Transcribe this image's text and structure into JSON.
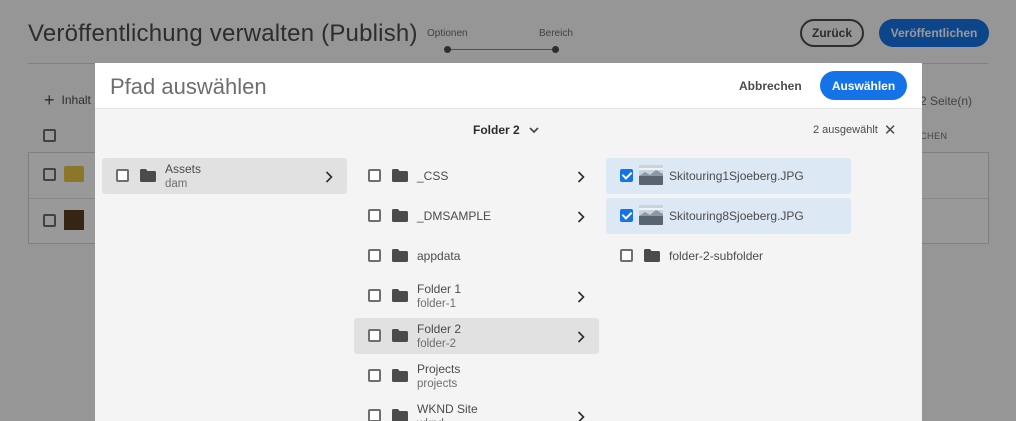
{
  "background": {
    "page_title": "Veröffentlichung verwalten (Publish)",
    "steps": [
      "Optionen",
      "Bereich"
    ],
    "back_label": "Zurück",
    "publish_label": "Veröffentlichen",
    "add_content_label": "Inhalt",
    "page_count": "2 Seite(n)",
    "column_header": "CHEN"
  },
  "dialog": {
    "title": "Pfad auswählen",
    "cancel_label": "Abbrechen",
    "select_label": "Auswählen",
    "current_folder": "Folder 2",
    "selected_count": "2 ausgewählt"
  },
  "columns": [
    {
      "items": [
        {
          "title": "Assets",
          "subtitle": "dam",
          "icon": "folder-icon",
          "checked": false,
          "has_children": true,
          "highlight": "grey"
        }
      ]
    },
    {
      "items": [
        {
          "title": "_CSS",
          "subtitle": "",
          "icon": "folder-icon",
          "checked": false,
          "has_children": true,
          "highlight": ""
        },
        {
          "title": "_DMSAMPLE",
          "subtitle": "",
          "icon": "folder-icon",
          "checked": false,
          "has_children": true,
          "highlight": ""
        },
        {
          "title": "appdata",
          "subtitle": "",
          "icon": "folder-icon",
          "checked": false,
          "has_children": false,
          "highlight": ""
        },
        {
          "title": "Folder 1",
          "subtitle": "folder-1",
          "icon": "folder-icon",
          "checked": false,
          "has_children": true,
          "highlight": ""
        },
        {
          "title": "Folder 2",
          "subtitle": "folder-2",
          "icon": "folder-icon",
          "checked": false,
          "has_children": true,
          "highlight": "grey"
        },
        {
          "title": "Projects",
          "subtitle": "projects",
          "icon": "folder-icon",
          "checked": false,
          "has_children": false,
          "highlight": ""
        },
        {
          "title": "WKND Site",
          "subtitle": "wknd",
          "icon": "folder-icon",
          "checked": false,
          "has_children": true,
          "highlight": ""
        }
      ]
    },
    {
      "items": [
        {
          "title": "Skitouring1Sjoeberg.JPG",
          "subtitle": "",
          "icon": "image-thumbnail",
          "checked": true,
          "has_children": false,
          "highlight": "blue"
        },
        {
          "title": "Skitouring8Sjoeberg.JPG",
          "subtitle": "",
          "icon": "image-thumbnail",
          "checked": true,
          "has_children": false,
          "highlight": "blue"
        },
        {
          "title": "folder-2-subfolder",
          "subtitle": "",
          "icon": "folder-icon",
          "checked": false,
          "has_children": false,
          "highlight": ""
        }
      ]
    }
  ],
  "colors": {
    "accent": "#1473e6",
    "selection_blue": "#dde8f5",
    "selection_grey": "#e1e1e1"
  }
}
